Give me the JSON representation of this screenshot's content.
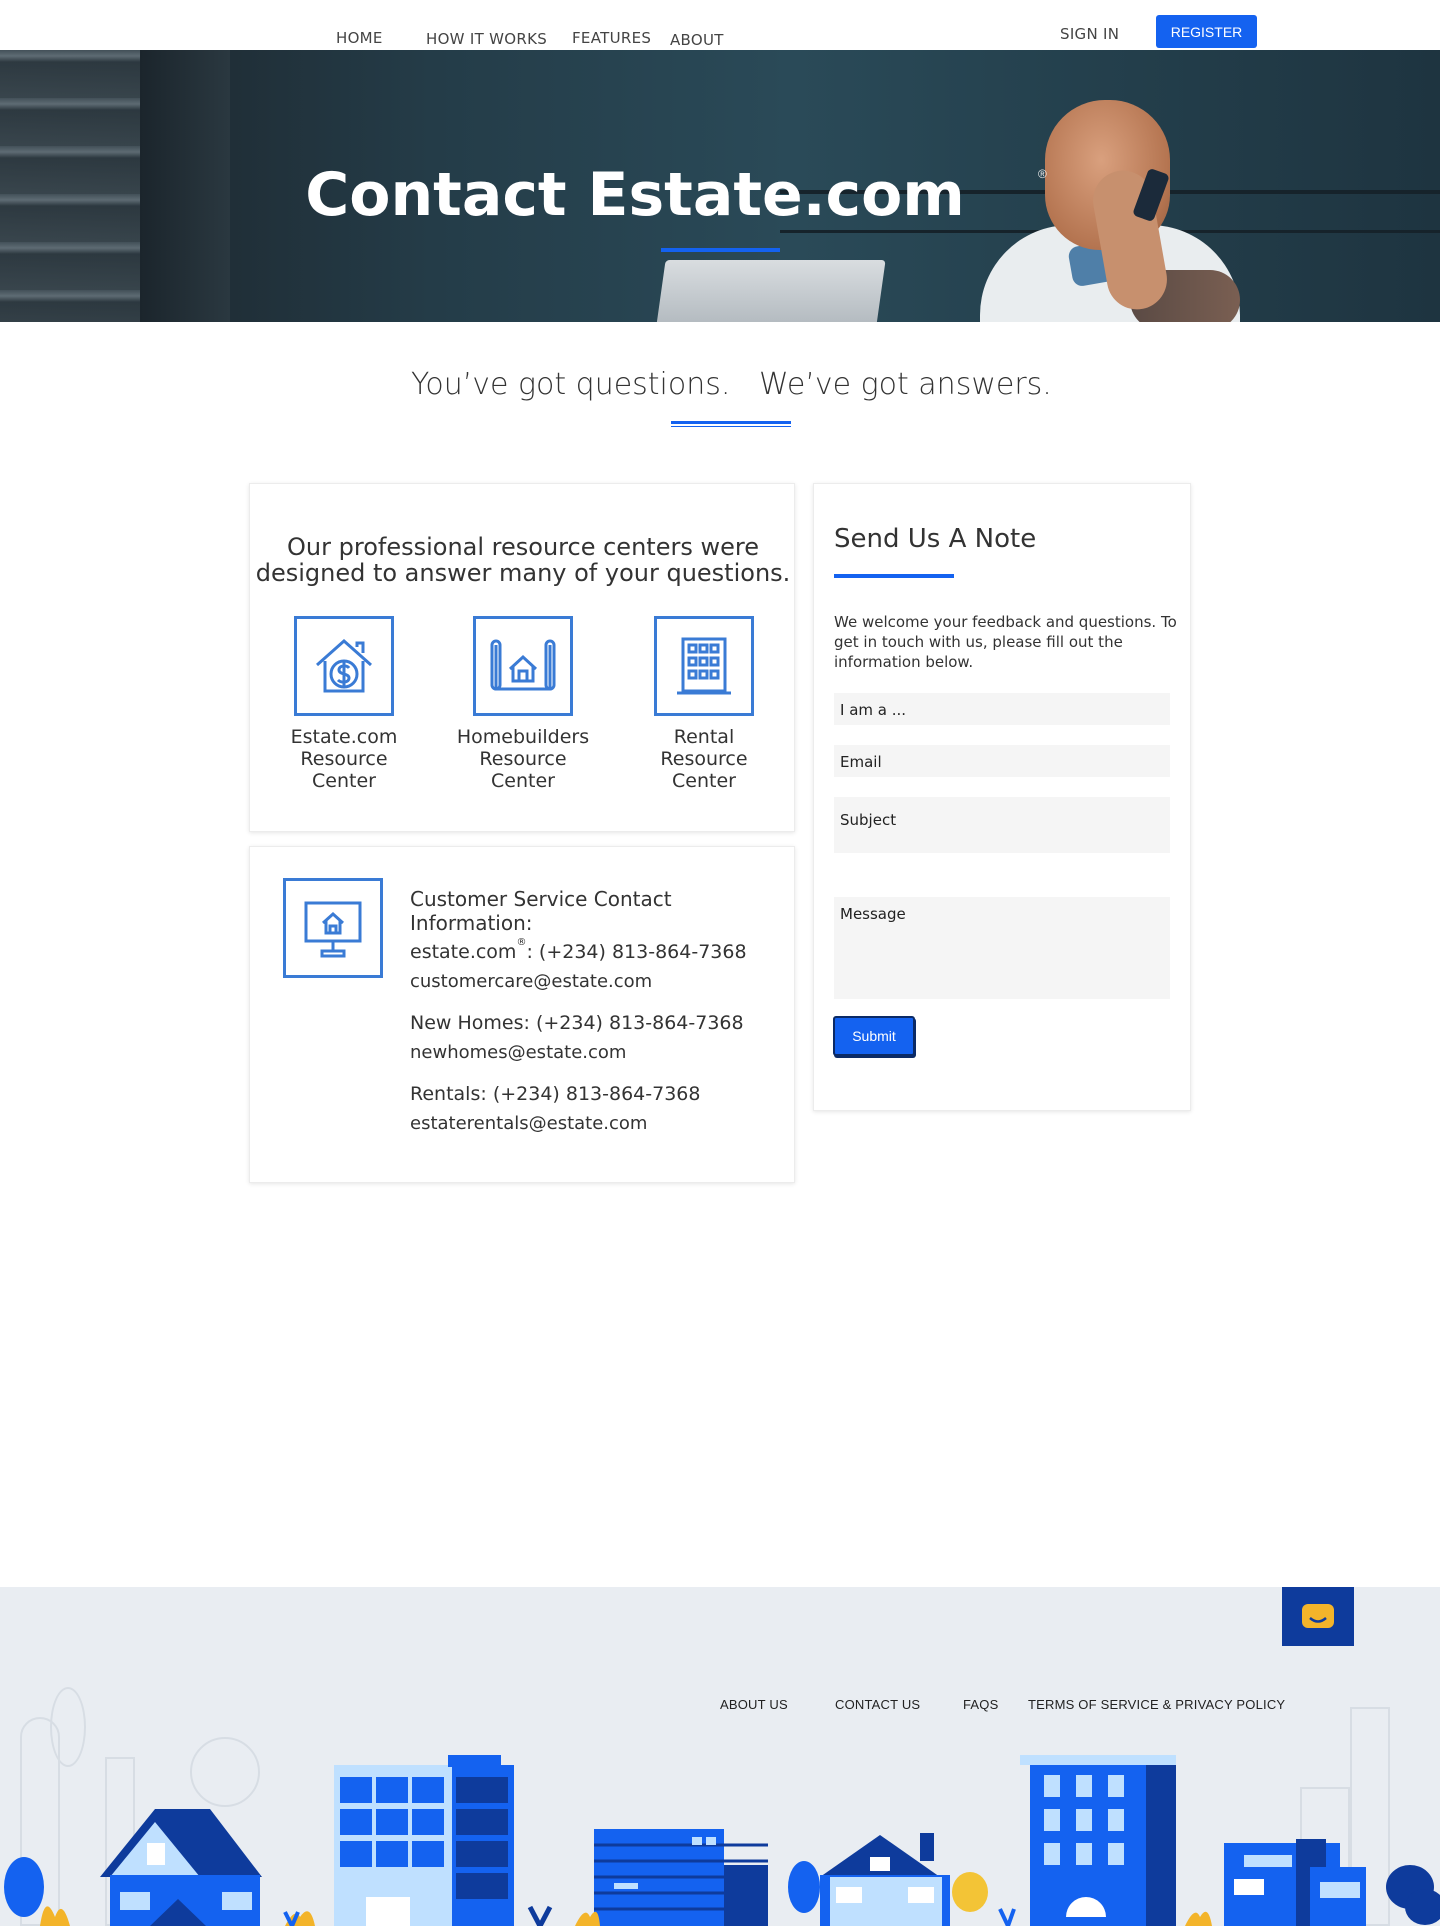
{
  "nav": {
    "links": [
      "HOME",
      "HOW IT WORKS",
      "FEATURES",
      "ABOUT"
    ],
    "sign_in": "SIGN IN",
    "register": "REGISTER"
  },
  "hero": {
    "title": "Contact Estate.com",
    "registered_mark": "®"
  },
  "tagline": {
    "left": "You’ve got questions.",
    "right": "We’ve got answers."
  },
  "resources": {
    "heading": "Our professional resource centers were designed to answer many of your questions.",
    "items": [
      {
        "label_lines": [
          "Estate.com",
          "Resource",
          "Center"
        ],
        "icon": "house-dollar-icon"
      },
      {
        "label_lines": [
          "Homebuilders",
          "Resource",
          "Center"
        ],
        "icon": "blueprint-house-icon"
      },
      {
        "label_lines": [
          "Rental",
          "Resource",
          "Center"
        ],
        "icon": "apartment-building-icon"
      }
    ]
  },
  "contact": {
    "icon": "monitor-house-icon",
    "title": "Customer Service Contact Information:",
    "entries": [
      {
        "label": "estate.com",
        "sup": "®",
        "separator": ":",
        "phone": "(+234) 813-864-7368",
        "email": "customercare@estate.com"
      },
      {
        "label": "New Homes:",
        "phone": "(+234) 813-864-7368",
        "email": "newhomes@estate.com"
      },
      {
        "label": "Rentals:",
        "phone": "(+234) 813-864-7368",
        "email": "estaterentals@estate.com"
      }
    ]
  },
  "note_form": {
    "title": "Send Us A Note",
    "description": "We welcome your feedback and questions. To get in touch with us, please fill out the information below.",
    "fields": {
      "role": "I am a ...",
      "email": "Email",
      "subject": "Subject",
      "message": "Message"
    },
    "submit": "Submit"
  },
  "footer": {
    "links": [
      "ABOUT US",
      "CONTACT US",
      "FAQS",
      "TERMS OF SERVICE & PRIVACY POLICY"
    ],
    "chat_icon": "chat-icon"
  },
  "colors": {
    "accent": "#1462f0",
    "icon_blue": "#3a7bd5",
    "footer_bg": "#e9edf2",
    "chat_bg": "#0e3b9c",
    "chat_icon": "#f3b42a"
  }
}
